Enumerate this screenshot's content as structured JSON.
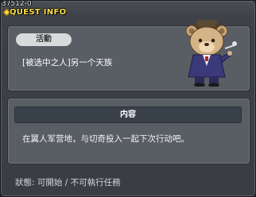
{
  "window": {
    "quest_id": "37512-0",
    "title": "QUEST INFO"
  },
  "summary": {
    "category_label": "活動",
    "quest_name": "[被选中之人]另一个天族"
  },
  "npc": {
    "icon": "bear-npc-icon"
  },
  "content": {
    "section_label": "内容",
    "description": "在翼人军营地，与切奇投入一起下次行动吧。"
  },
  "status": {
    "text": "狀態:  可開始  /  不可執行任務"
  }
}
